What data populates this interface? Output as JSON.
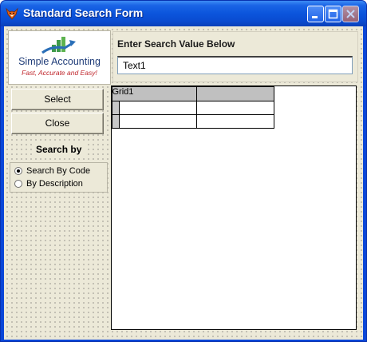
{
  "window": {
    "title": "Standard Search Form",
    "icon": "fox-app-icon"
  },
  "logo": {
    "name": "Simple Accounting",
    "tagline": "Fast, Accurate and Easy!",
    "colors": {
      "name": "#1f3c78",
      "tagline": "#c0272d",
      "bar_green": "#3f9b4a",
      "arrow_blue": "#2a6fb8"
    }
  },
  "search": {
    "label": "Enter Search Value Below",
    "value": "Text1"
  },
  "buttons": {
    "select_label": "Select",
    "close_label": "Close"
  },
  "search_by": {
    "label": "Search by",
    "options": [
      {
        "label": "Search By Code",
        "selected": true
      },
      {
        "label": "By Description",
        "selected": false
      }
    ]
  },
  "grid": {
    "caption": "Grid1",
    "columns": [
      "",
      ""
    ],
    "rows": [
      [
        "",
        ""
      ],
      [
        "",
        ""
      ]
    ]
  }
}
